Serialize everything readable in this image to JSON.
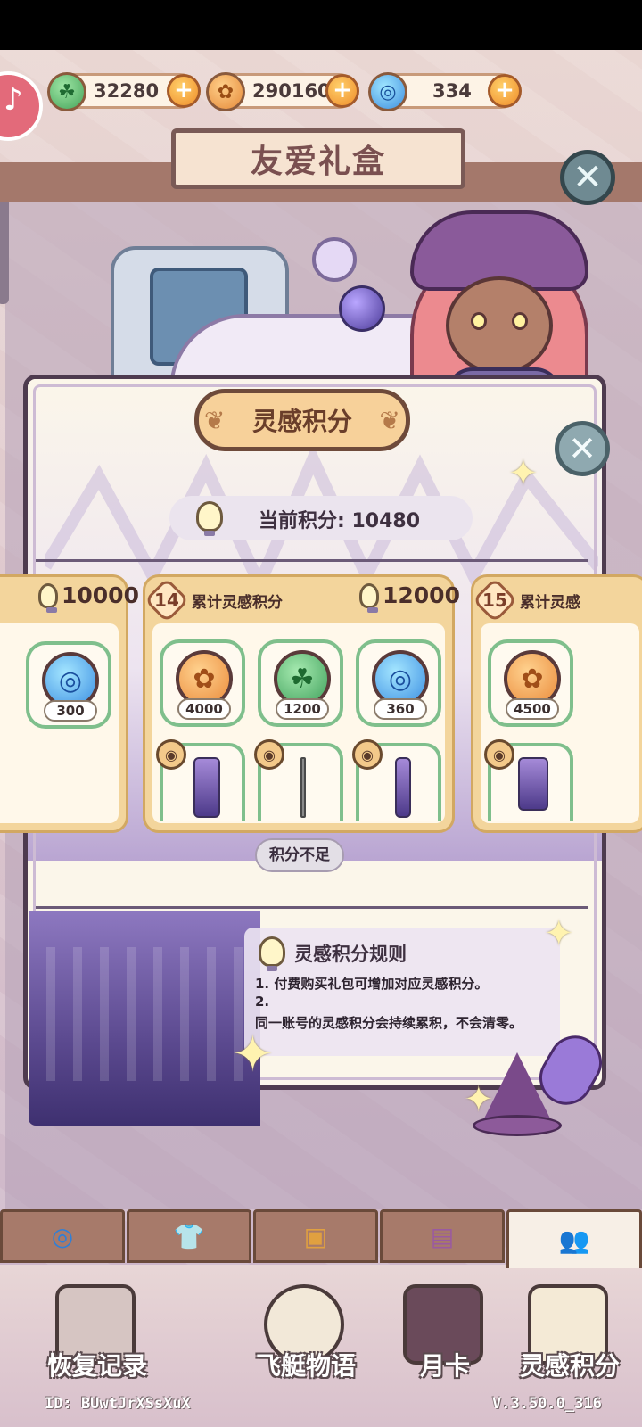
{
  "currencies": [
    {
      "icon": "clover-coin-icon",
      "amount": "32280",
      "color": "#45a35a"
    },
    {
      "icon": "bloom-coin-icon",
      "amount": "290160",
      "color": "#e58a3a"
    },
    {
      "icon": "swirl-gem-icon",
      "amount": "334",
      "color": "#3f8fe0"
    }
  ],
  "header": {
    "title": "友爱礼盒"
  },
  "dialog": {
    "title": "灵感积分",
    "current_points_label": "当前积分: 10480",
    "insufficient_label": "积分不足"
  },
  "tiers": [
    {
      "req": "10000",
      "rewards": [
        {
          "type": "swirl-gem",
          "qty": "300"
        }
      ]
    },
    {
      "num": "14",
      "title": "累计灵感积分",
      "req": "12000",
      "rewards": [
        {
          "type": "bloom-coin",
          "qty": "4000"
        },
        {
          "type": "clover-coin",
          "qty": "1200"
        },
        {
          "type": "swirl-gem",
          "qty": "360"
        }
      ]
    },
    {
      "num": "15",
      "title": "累计灵感",
      "rewards": [
        {
          "type": "bloom-coin",
          "qty": "4500"
        }
      ]
    }
  ],
  "rules": {
    "title": "灵感积分规则",
    "line1": "1. 付费购买礼包可增加对应灵感积分。",
    "line2": "2.",
    "line3": "同一账号的灵感积分会持续累积，不会清零。"
  },
  "bottom_nav": [
    {
      "label": "恢复记录",
      "icon": "clipboard-icon"
    },
    {
      "label": "飞艇物语",
      "icon": "flower-ticket-icon"
    },
    {
      "label": "月卡",
      "icon": "card-icon"
    },
    {
      "label": "灵感积分",
      "icon": "bulb-frame-icon"
    }
  ],
  "footer": {
    "id": "ID: BUwtJrXSsXuX",
    "version": "V.3.50.0_316"
  },
  "colors": {
    "accent": "#f7d19a",
    "border": "#4e3b4f",
    "green_frame": "#7fbf8c"
  }
}
